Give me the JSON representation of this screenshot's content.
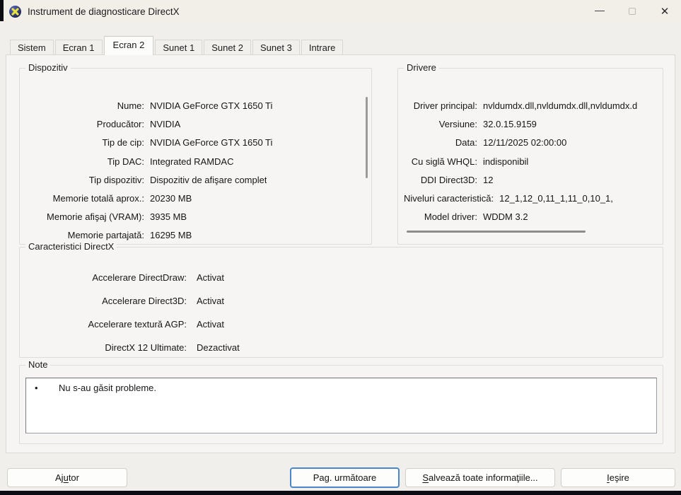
{
  "window": {
    "title": "Instrument de diagnosticare DirectX",
    "controls": {
      "minimize": "—",
      "close": "✕"
    }
  },
  "tabs": [
    {
      "label": "Sistem"
    },
    {
      "label": "Ecran 1"
    },
    {
      "label": "Ecran 2",
      "active": true
    },
    {
      "label": "Sunet 1"
    },
    {
      "label": "Sunet 2"
    },
    {
      "label": "Sunet 3"
    },
    {
      "label": "Intrare"
    }
  ],
  "groups": {
    "device": {
      "title": "Dispozitiv",
      "rows": [
        {
          "label": "Nume:",
          "value": "NVIDIA GeForce GTX 1650 Ti"
        },
        {
          "label": "Producător:",
          "value": "NVIDIA"
        },
        {
          "label": "Tip de cip:",
          "value": "NVIDIA GeForce GTX 1650 Ti"
        },
        {
          "label": "Tip DAC:",
          "value": "Integrated RAMDAC"
        },
        {
          "label": "Tip dispozitiv:",
          "value": "Dispozitiv de afişare complet"
        },
        {
          "label": "Memorie totală aprox.:",
          "value": "20230 MB"
        },
        {
          "label": "Memorie afişaj (VRAM):",
          "value": "3935 MB"
        },
        {
          "label": "Memorie partajată:",
          "value": "16295 MB"
        }
      ]
    },
    "drivers": {
      "title": "Drivere",
      "rows": [
        {
          "label": "Driver principal:",
          "value": "nvldumdx.dll,nvldumdx.dll,nvldumdx.d"
        },
        {
          "label": "Versiune:",
          "value": "32.0.15.9159"
        },
        {
          "label": "Data:",
          "value": "12/11/2025 02:00:00"
        },
        {
          "label": "Cu siglă WHQL:",
          "value": "indisponibil"
        },
        {
          "label": "DDI Direct3D:",
          "value": "12"
        },
        {
          "label": "Niveluri caracteristică:",
          "value": "12_1,12_0,11_1,11_0,10_1,"
        },
        {
          "label": "Model driver:",
          "value": "WDDM 3.2"
        }
      ]
    },
    "features": {
      "title": "Caracteristici DirectX",
      "rows": [
        {
          "label": "Accelerare DirectDraw:",
          "value": "Activat"
        },
        {
          "label": "Accelerare Direct3D:",
          "value": "Activat"
        },
        {
          "label": "Accelerare textură AGP:",
          "value": "Activat"
        },
        {
          "label": "DirectX 12 Ultimate:",
          "value": "Dezactivat"
        }
      ]
    },
    "notes": {
      "title": "Note",
      "bullet": "•",
      "items": [
        "Nu s-au găsit probleme."
      ]
    }
  },
  "buttons": {
    "help": {
      "pre": "Aj",
      "key": "u",
      "post": "tor"
    },
    "next": {
      "pre": "",
      "key": "",
      "post": "Pag. următoare"
    },
    "save": {
      "pre": "",
      "key": "S",
      "post": "alvează toate informaţiile..."
    },
    "exit": {
      "pre": "",
      "key": "I",
      "post": "eşire"
    }
  },
  "colors": {
    "titlebar_bg": "#f2efe9",
    "panel_bg": "#f6f5f3",
    "focus_border": "#4a86c8",
    "icon_blue": "#2a2d5e",
    "icon_yellow": "#e8e23a"
  }
}
